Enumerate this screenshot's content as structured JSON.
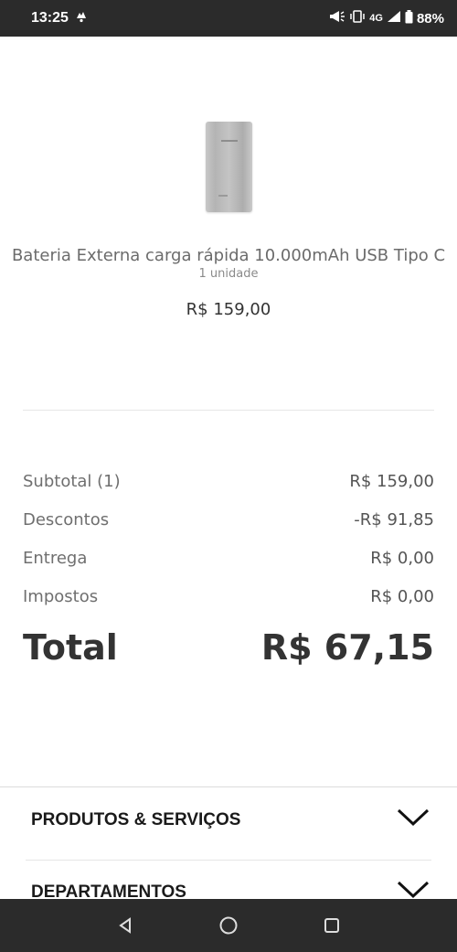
{
  "status_bar": {
    "time": "13:25",
    "network": "4G",
    "battery": "88%"
  },
  "product": {
    "image_alt": "Bateria externa",
    "name": "Bateria Externa carga rápida 10.000mAh USB Tipo C",
    "quantity": "1 unidade",
    "price": "R$ 159,00"
  },
  "summary": {
    "rows": [
      {
        "label": "Subtotal (1)",
        "value": "R$ 159,00"
      },
      {
        "label": "Descontos",
        "value": "-R$ 91,85"
      },
      {
        "label": "Entrega",
        "value": "R$ 0,00"
      },
      {
        "label": "Impostos",
        "value": "R$ 0,00"
      }
    ],
    "total_label": "Total",
    "total_value": "R$ 67,15"
  },
  "accordion": {
    "items": [
      {
        "label": "PRODUTOS & SERVIÇOS"
      },
      {
        "label": "DEPARTAMENTOS"
      }
    ]
  },
  "icons": {
    "back": "back-triangle-icon",
    "home": "home-circle-icon",
    "recents": "recents-square-icon",
    "chevron": "chevron-down-icon"
  }
}
